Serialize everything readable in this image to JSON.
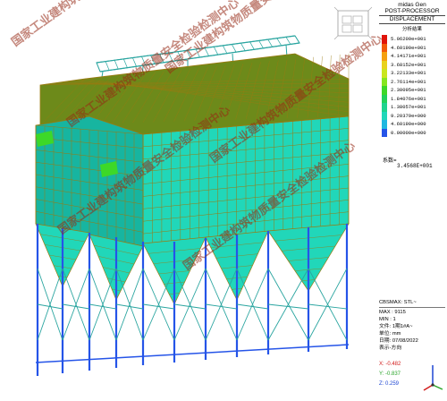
{
  "legend": {
    "app_title": "midas Gen",
    "mode": "POST-PROCESSOR",
    "result_type": "DISPLACEMENT",
    "subtitle": "分析结果",
    "scale": [
      {
        "value": "5.06209e+001",
        "color": "#e0140a"
      },
      {
        "value": "4.60190e+001",
        "color": "#f25a0a"
      },
      {
        "value": "4.14171e+001",
        "color": "#f5a00f"
      },
      {
        "value": "3.68152e+001",
        "color": "#e8d21c"
      },
      {
        "value": "3.22133e+001",
        "color": "#c9e61e"
      },
      {
        "value": "2.76114e+001",
        "color": "#86e61f"
      },
      {
        "value": "2.30095e+001",
        "color": "#3dd828"
      },
      {
        "value": "1.84076e+001",
        "color": "#22d25a"
      },
      {
        "value": "1.38057e+001",
        "color": "#1ed48e"
      },
      {
        "value": "9.20379e+000",
        "color": "#21d7b9"
      },
      {
        "value": "4.60190e+000",
        "color": "#1fb7e0"
      },
      {
        "value": "0.00000e+000",
        "color": "#2554e8"
      }
    ],
    "factor_label": "系数=",
    "factor_value": "3.4568E+001"
  },
  "info": {
    "cbs": "CBSMAX: STL~",
    "max": "MAX : 9115",
    "min": "MIN : 1",
    "file": "文件: 1期1#A~",
    "unit": "单位: mm",
    "date": "日期: 07/08/2022",
    "view": "表示-方向"
  },
  "axes": {
    "x": "X: -0.482",
    "y": "Y: -0.837",
    "z": "Z: 0.259",
    "x_color": "#d21e1e",
    "y_color": "#2aa52a",
    "z_color": "#1e46d2"
  },
  "watermark": {
    "text": "国家工业建构筑物质量安全检验检测中心"
  },
  "colors": {
    "panel_fill": "#21d7b9",
    "panel_fill_dark": "#17b5a0",
    "beam_line": "#9a7a10",
    "roof_fill": "#6d8a1a",
    "column_blue": "#2554e8",
    "highlight_green": "#3dd828"
  }
}
